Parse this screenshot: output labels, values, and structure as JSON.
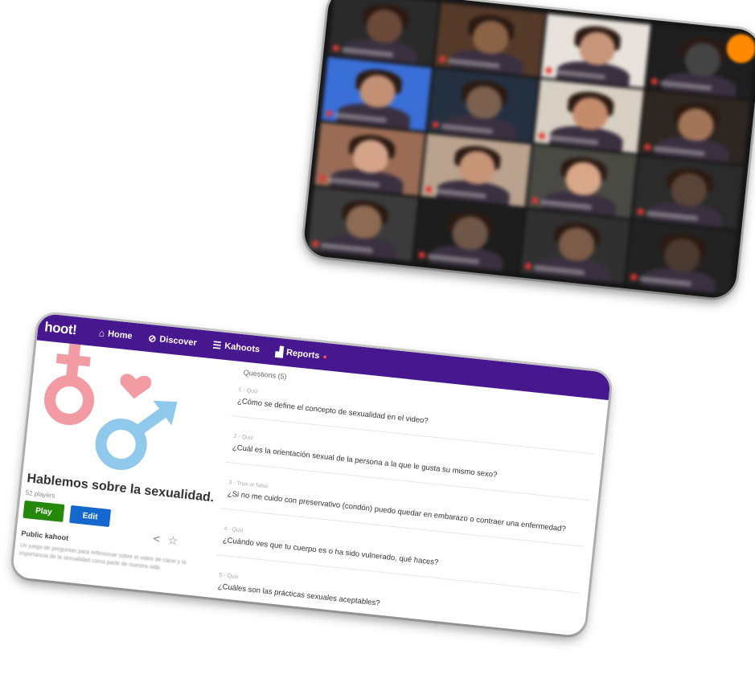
{
  "kahoot": {
    "brand": "hoot!",
    "nav": [
      {
        "label": "Home",
        "icon": "home-icon",
        "glyph": "⌂"
      },
      {
        "label": "Discover",
        "icon": "compass-icon",
        "glyph": "⊘"
      },
      {
        "label": "Kahoots",
        "icon": "list-icon",
        "glyph": "☰"
      },
      {
        "label": "Reports",
        "icon": "bar-chart-icon",
        "glyph": "▟"
      }
    ],
    "title": "Hablemos sobre la sexualidad.",
    "plays": "52 players",
    "play_label": "Play",
    "edit_label": "Edit",
    "visibility": "Public kahoot",
    "description": "Un juego de preguntas para reflexionar sobre el video de clase y la importancia de la sexualidad como parte de nuestra vida.",
    "questions_header": "Questions (5)",
    "questions": [
      {
        "type": "1 - Quiz",
        "text": "¿Cómo se define el concepto de sexualidad en el video?"
      },
      {
        "type": "2 - Quiz",
        "text": "¿Cuál es la orientación sexual de la persona a la que le gusta su mismo sexo?"
      },
      {
        "type": "3 - True or false",
        "text": "¿Si no me cuido con preservativo (condón) puedo quedar en embarazo o contraer una enfermedad?"
      },
      {
        "type": "4 - Quiz",
        "text": "¿Cuándo ves que tu cuerpo es o ha sido vulnerado, qué haces?"
      },
      {
        "type": "5 - Quiz",
        "text": "¿Cuáles son las prácticas sexuales aceptables?"
      }
    ],
    "colors": {
      "topbar": "#46178f",
      "play": "#26890c",
      "edit": "#1368ce"
    }
  },
  "call": {
    "tiles": [
      {
        "bg": "#2a2a2a",
        "skin": "#6b4a3a"
      },
      {
        "bg": "#553a2a",
        "skin": "#8a6347"
      },
      {
        "bg": "#e8e2dc",
        "skin": "#c7967a"
      },
      {
        "bg": "#1e1e1e",
        "skin": "#444"
      },
      {
        "bg": "#3a6fd8",
        "skin": "#c39074"
      },
      {
        "bg": "#243040",
        "skin": "#7b6050"
      },
      {
        "bg": "#d8cfc4",
        "skin": "#c58c6c"
      },
      {
        "bg": "#2e2620",
        "skin": "#a27558"
      },
      {
        "bg": "#9a6c55",
        "skin": "#d4a38a"
      },
      {
        "bg": "#b9a28e",
        "skin": "#c69477"
      },
      {
        "bg": "#4a4a44",
        "skin": "#d8a688"
      },
      {
        "bg": "#2b2b2b",
        "skin": "#5a4438"
      },
      {
        "bg": "#3b3b3b",
        "skin": "#8d6a52"
      },
      {
        "bg": "#1d1d1d",
        "skin": "#6e5648"
      },
      {
        "bg": "#303030",
        "skin": "#7c5c48"
      },
      {
        "bg": "#222222",
        "skin": "#4a3a30"
      }
    ],
    "accent": "#ff8a00"
  }
}
